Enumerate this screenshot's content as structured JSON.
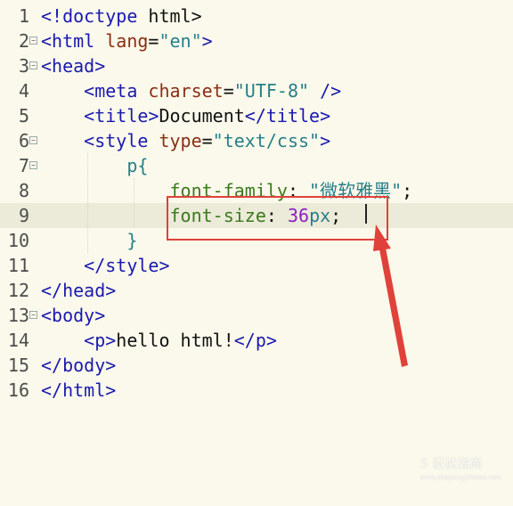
{
  "lines": [
    {
      "n": "1",
      "tokens": [
        {
          "t": "<!",
          "c": "c-tag"
        },
        {
          "t": "doctype",
          "c": "c-tag"
        },
        {
          "t": " html>",
          "c": "c-txt"
        }
      ]
    },
    {
      "n": "2",
      "fold": "⊟",
      "tokens": [
        {
          "t": "<html ",
          "c": "c-tag"
        },
        {
          "t": "lang",
          "c": "c-attr"
        },
        {
          "t": "=",
          "c": "c-txt"
        },
        {
          "t": "\"en\"",
          "c": "c-str"
        },
        {
          "t": ">",
          "c": "c-tag"
        }
      ]
    },
    {
      "n": "3",
      "fold": "⊟",
      "tokens": [
        {
          "t": "<head>",
          "c": "c-tag"
        }
      ]
    },
    {
      "n": "4",
      "tokens": [
        {
          "t": "    <meta ",
          "c": "c-tag"
        },
        {
          "t": "charset",
          "c": "c-attr"
        },
        {
          "t": "=",
          "c": "c-txt"
        },
        {
          "t": "\"UTF-8\"",
          "c": "c-str"
        },
        {
          "t": " />",
          "c": "c-tag"
        }
      ]
    },
    {
      "n": "5",
      "tokens": [
        {
          "t": "    <title>",
          "c": "c-tag"
        },
        {
          "t": "Document",
          "c": "c-txt"
        },
        {
          "t": "</title>",
          "c": "c-tag"
        }
      ]
    },
    {
      "n": "6",
      "fold": "⊟",
      "tokens": [
        {
          "t": "    <style ",
          "c": "c-tag"
        },
        {
          "t": "type",
          "c": "c-attr"
        },
        {
          "t": "=",
          "c": "c-txt"
        },
        {
          "t": "\"text/css\"",
          "c": "c-str"
        },
        {
          "t": ">",
          "c": "c-tag"
        }
      ]
    },
    {
      "n": "7",
      "fold": "⊟",
      "tokens": [
        {
          "t": "        p{",
          "c": "c-str"
        }
      ]
    },
    {
      "n": "8",
      "tokens": [
        {
          "t": "            ",
          "c": "c-txt"
        },
        {
          "t": "font-family",
          "c": "c-prop"
        },
        {
          "t": ": ",
          "c": "c-txt"
        },
        {
          "t": "\"微软雅黑\"",
          "c": "c-str"
        },
        {
          "t": ";",
          "c": "c-txt"
        }
      ]
    },
    {
      "n": "9",
      "current": true,
      "tokens": [
        {
          "t": "            ",
          "c": "c-txt"
        },
        {
          "t": "font-size",
          "c": "c-prop"
        },
        {
          "t": ": ",
          "c": "c-txt"
        },
        {
          "t": "36",
          "c": "c-num"
        },
        {
          "t": "px",
          "c": "c-str"
        },
        {
          "t": ";",
          "c": "c-txt"
        }
      ]
    },
    {
      "n": "10",
      "tokens": [
        {
          "t": "        }",
          "c": "c-str"
        }
      ]
    },
    {
      "n": "11",
      "tokens": [
        {
          "t": "    </style>",
          "c": "c-tag"
        }
      ]
    },
    {
      "n": "12",
      "tokens": [
        {
          "t": "</head>",
          "c": "c-tag"
        }
      ]
    },
    {
      "n": "13",
      "fold": "⊟",
      "tokens": [
        {
          "t": "<body>",
          "c": "c-tag"
        }
      ]
    },
    {
      "n": "14",
      "tokens": [
        {
          "t": "    <p>",
          "c": "c-tag"
        },
        {
          "t": "hello html!",
          "c": "c-txt"
        },
        {
          "t": "</p>",
          "c": "c-tag"
        }
      ]
    },
    {
      "n": "15",
      "tokens": [
        {
          "t": "</body>",
          "c": "c-tag"
        }
      ]
    },
    {
      "n": "16",
      "tokens": [
        {
          "t": "</html>",
          "c": "c-tag"
        }
      ]
    }
  ],
  "annotation": {
    "color": "#e0413a",
    "icon": "arrow-up-icon"
  },
  "watermark": {
    "main": "S 轻松指南",
    "sub": "www.qingsongzhinan.com"
  }
}
